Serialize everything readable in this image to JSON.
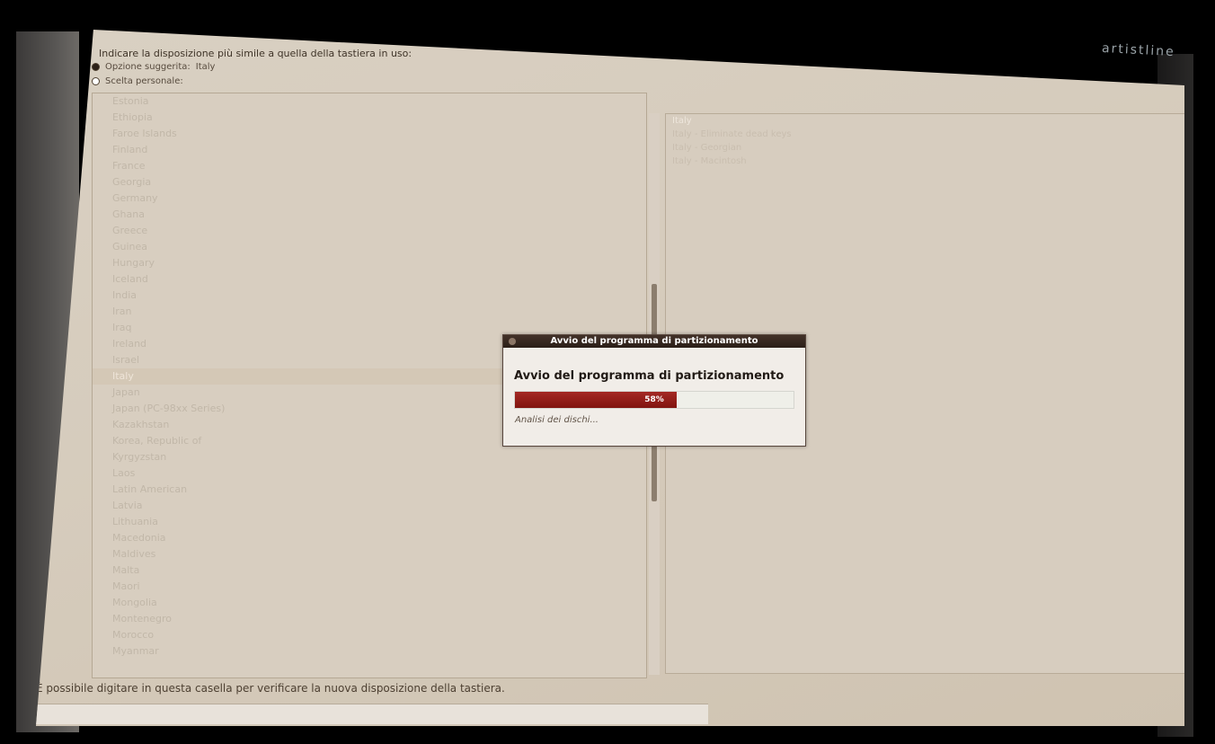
{
  "brand": {
    "label": "artistline"
  },
  "header": {
    "instruction": "Indicare la disposizione più simile a quella della tastiera in uso:",
    "option_suggested_label": "Opzione suggerita:",
    "option_suggested_value": "Italy",
    "option_custom_label": "Scelta personale:"
  },
  "left_list": {
    "items": [
      "Estonia",
      "Ethiopia",
      "Faroe Islands",
      "Finland",
      "France",
      "Georgia",
      "Germany",
      "Ghana",
      "Greece",
      "Guinea",
      "Hungary",
      "Iceland",
      "India",
      "Iran",
      "Iraq",
      "Ireland",
      "Israel",
      "Italy",
      "Japan",
      "Japan (PC-98xx Series)",
      "Kazakhstan",
      "Korea, Republic of",
      "Kyrgyzstan",
      "Laos",
      "Latin American",
      "Latvia",
      "Lithuania",
      "Macedonia",
      "Maldives",
      "Malta",
      "Maori",
      "Mongolia",
      "Montenegro",
      "Morocco",
      "Myanmar"
    ],
    "selected_index": 17
  },
  "right_list": {
    "items": [
      "Italy",
      "Italy - Eliminate dead keys",
      "Italy - Georgian",
      "Italy - Macintosh"
    ],
    "selected_index": 0
  },
  "dialog": {
    "title": "Avvio del programma di partizionamento",
    "heading": "Avvio del programma di partizionamento",
    "progress": 0.58,
    "progress_text": "58%",
    "status": "Analisi dei dischi..."
  },
  "footer": {
    "test_label": "È possibile digitare in questa casella per verificare la nuova disposizione della tastiera."
  }
}
